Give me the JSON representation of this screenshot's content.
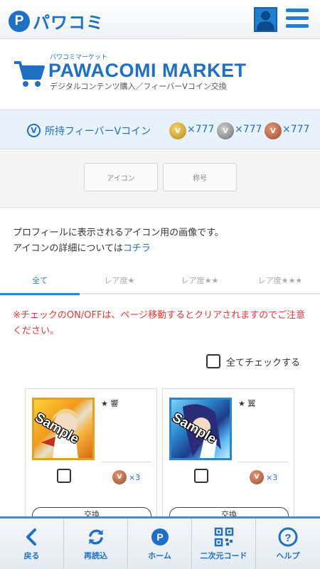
{
  "header": {
    "logo_letter": "P",
    "logo_text": "パワコミ"
  },
  "market": {
    "subtitle": "パワコミマーケット",
    "title": "PAWACOMI MARKET",
    "description": "デジタルコンテンツ購入／フィーバーVコイン交換"
  },
  "coins": {
    "badge": "V",
    "label": "所持フィーバーVコイン",
    "items": [
      {
        "value": "×777",
        "color": "#d6a62a"
      },
      {
        "value": "×777",
        "color": "#8f8f8f"
      },
      {
        "value": "×777",
        "color": "#a5552f"
      }
    ]
  },
  "category_tabs": [
    "アイコン",
    "称号"
  ],
  "description": {
    "line1": "プロフィールに表示されるアイコン用の画像です。",
    "line2_prefix": "アイコンの詳細については",
    "line2_link": "コチラ"
  },
  "rarity_tabs": [
    "全て",
    "レア度★",
    "レア度★★",
    "レア度★★★"
  ],
  "notice": "※チェックのON/OFFは、ページ移動するとクリアされますのでご注意ください。",
  "check_all_label": "全てチェックする",
  "cards": [
    {
      "name": "★ 響",
      "sample": "Sample",
      "quantity": "×3",
      "button": "交換"
    },
    {
      "name": "★ 翼",
      "sample": "Sample",
      "quantity": "×3",
      "button": "交換"
    }
  ],
  "nav": [
    "戻る",
    "再読込",
    "ホーム",
    "二次元コード",
    "ヘルプ"
  ],
  "colors": {
    "brand": "#1f6fc4",
    "notice": "#e33333"
  }
}
